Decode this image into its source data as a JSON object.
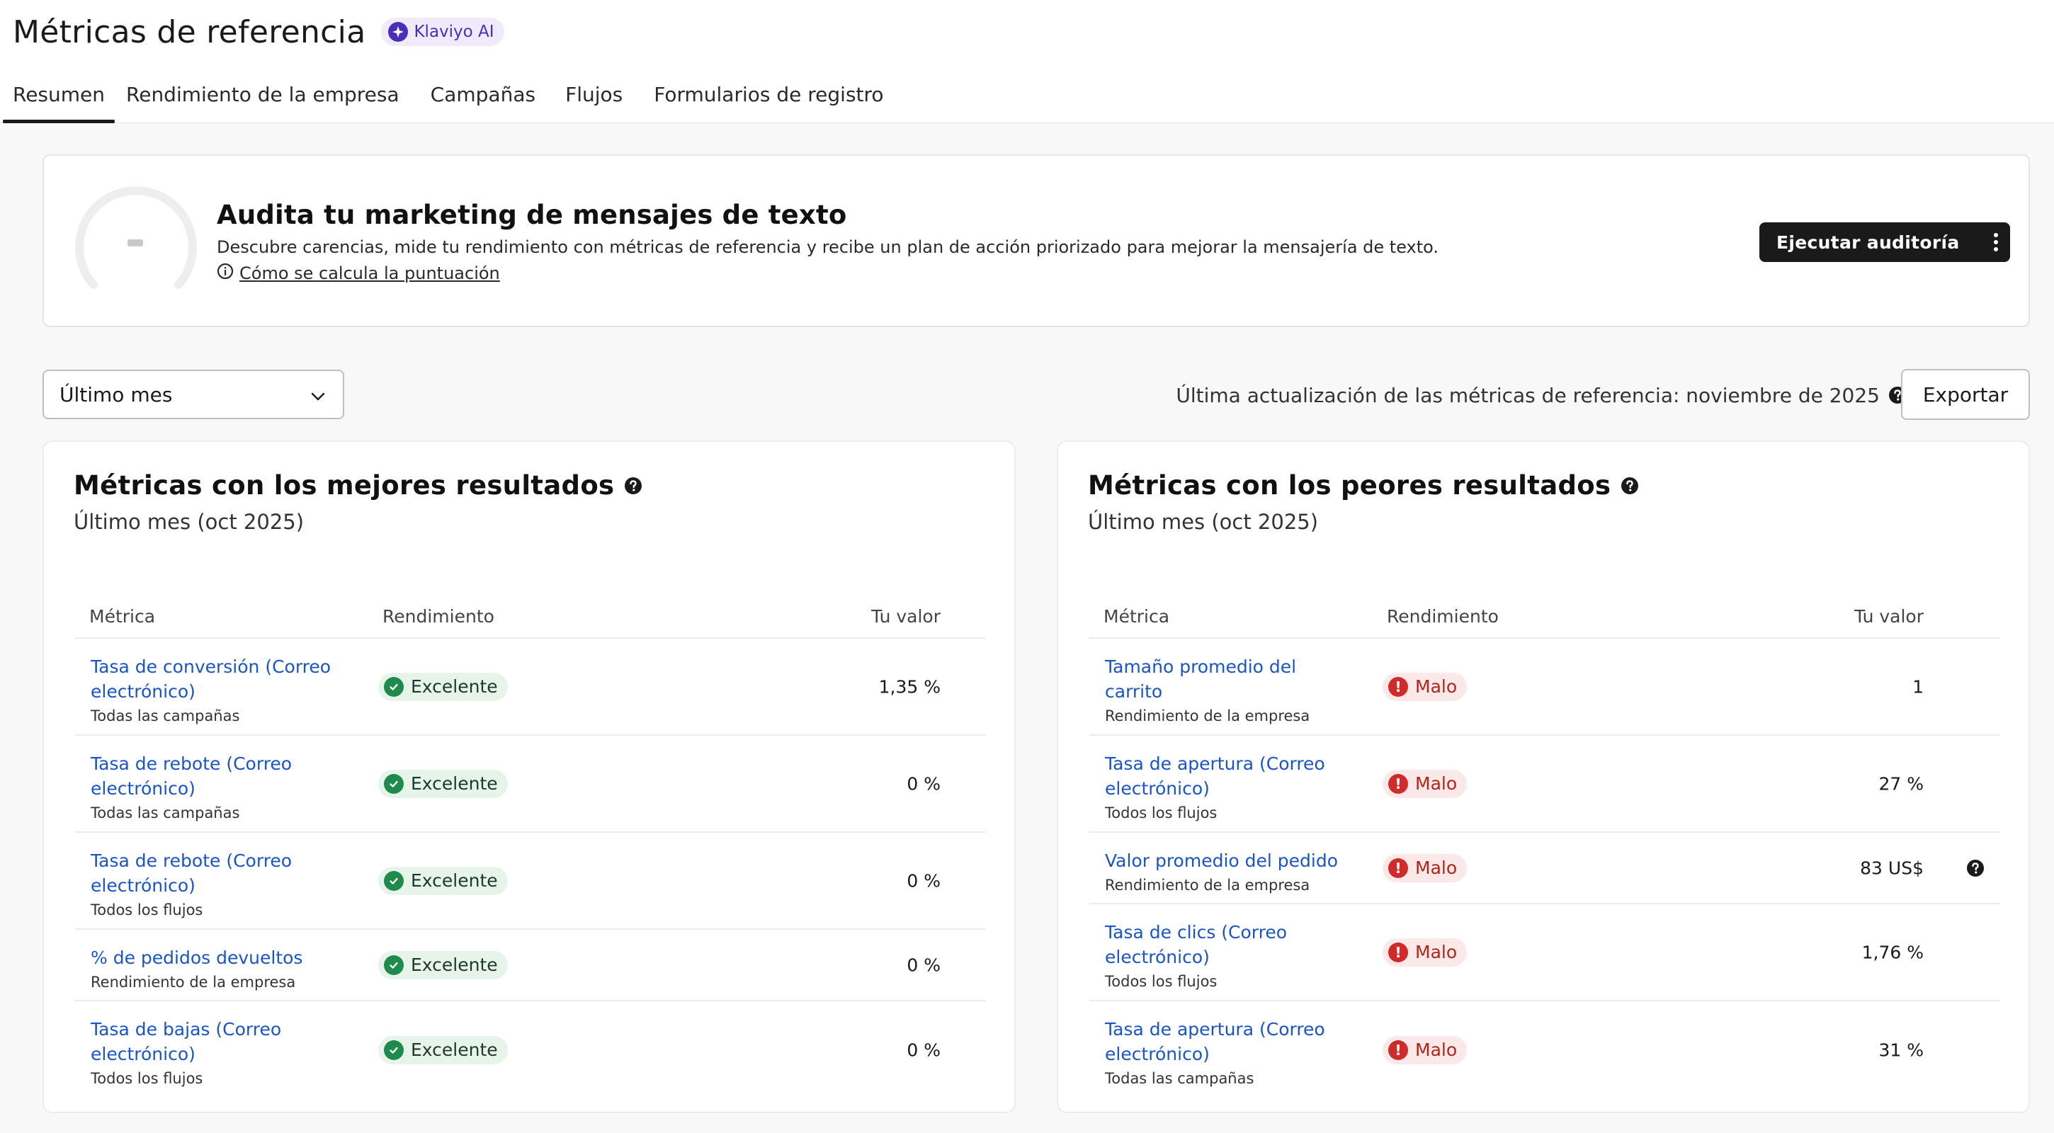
{
  "header": {
    "title": "Métricas de referencia",
    "ai_badge": "Klaviyo AI",
    "tabs": [
      {
        "label": "Resumen",
        "active": true
      },
      {
        "label": "Rendimiento de la empresa",
        "active": false
      },
      {
        "label": "Campañas",
        "active": false
      },
      {
        "label": "Flujos",
        "active": false
      },
      {
        "label": "Formularios de registro",
        "active": false
      }
    ]
  },
  "audit": {
    "title": "Audita tu marketing de mensajes de texto",
    "description": "Descubre carencias, mide tu rendimiento con métricas de referencia y recibe un plan de acción priorizado para mejorar la mensajería de texto.",
    "link": "Cómo se calcula la puntuación",
    "button": "Ejecutar auditoría"
  },
  "controls": {
    "period": "Último mes",
    "updated": "Última actualización de las métricas de referencia: noviembre de 2025",
    "export": "Exportar"
  },
  "best": {
    "title": "Métricas con los mejores resultados",
    "subtitle": "Último mes (oct 2025)",
    "columns": {
      "metric": "Métrica",
      "performance": "Rendimiento",
      "value": "Tu valor"
    },
    "rows": [
      {
        "name": "Tasa de conversión (Correo electrónico)",
        "scope": "Todas las campañas",
        "status": "Excelente",
        "value": "1,35 %"
      },
      {
        "name": "Tasa de rebote (Correo electrónico)",
        "scope": "Todas las campañas",
        "status": "Excelente",
        "value": "0 %"
      },
      {
        "name": "Tasa de rebote (Correo electrónico)",
        "scope": "Todos los flujos",
        "status": "Excelente",
        "value": "0 %"
      },
      {
        "name": "% de pedidos devueltos",
        "scope": "Rendimiento de la empresa",
        "status": "Excelente",
        "value": "0 %"
      },
      {
        "name": "Tasa de bajas (Correo electrónico)",
        "scope": "Todos los flujos",
        "status": "Excelente",
        "value": "0 %"
      }
    ]
  },
  "worst": {
    "title": "Métricas con los peores resultados",
    "subtitle": "Último mes (oct 2025)",
    "columns": {
      "metric": "Métrica",
      "performance": "Rendimiento",
      "value": "Tu valor"
    },
    "rows": [
      {
        "name": "Tamaño promedio del carrito",
        "scope": "Rendimiento de la empresa",
        "status": "Malo",
        "value": "1"
      },
      {
        "name": "Tasa de apertura (Correo electrónico)",
        "scope": "Todos los flujos",
        "status": "Malo",
        "value": "27 %"
      },
      {
        "name": "Valor promedio del pedido",
        "scope": "Rendimiento de la empresa",
        "status": "Malo",
        "value": "83 US$"
      },
      {
        "name": "Tasa de clics (Correo electrónico)",
        "scope": "Todos los flujos",
        "status": "Malo",
        "value": "1,76 %"
      },
      {
        "name": "Tasa de apertura (Correo electrónico)",
        "scope": "Todas las campañas",
        "status": "Malo",
        "value": "31 %"
      }
    ]
  },
  "colors": {
    "link": "#1a55c8",
    "good": "#1e8a4c",
    "bad": "#d12a2a",
    "ai_accent": "#4b2fb8",
    "dark_button": "#1a1a1a"
  },
  "icons": {
    "ai_badge": "sparkle-icon",
    "info": "info-circle-icon",
    "help": "question-circle-icon",
    "dropdown": "chevron-down-icon",
    "kebab": "more-vertical-icon",
    "good": "check-circle-icon",
    "bad": "exclamation-circle-icon"
  }
}
